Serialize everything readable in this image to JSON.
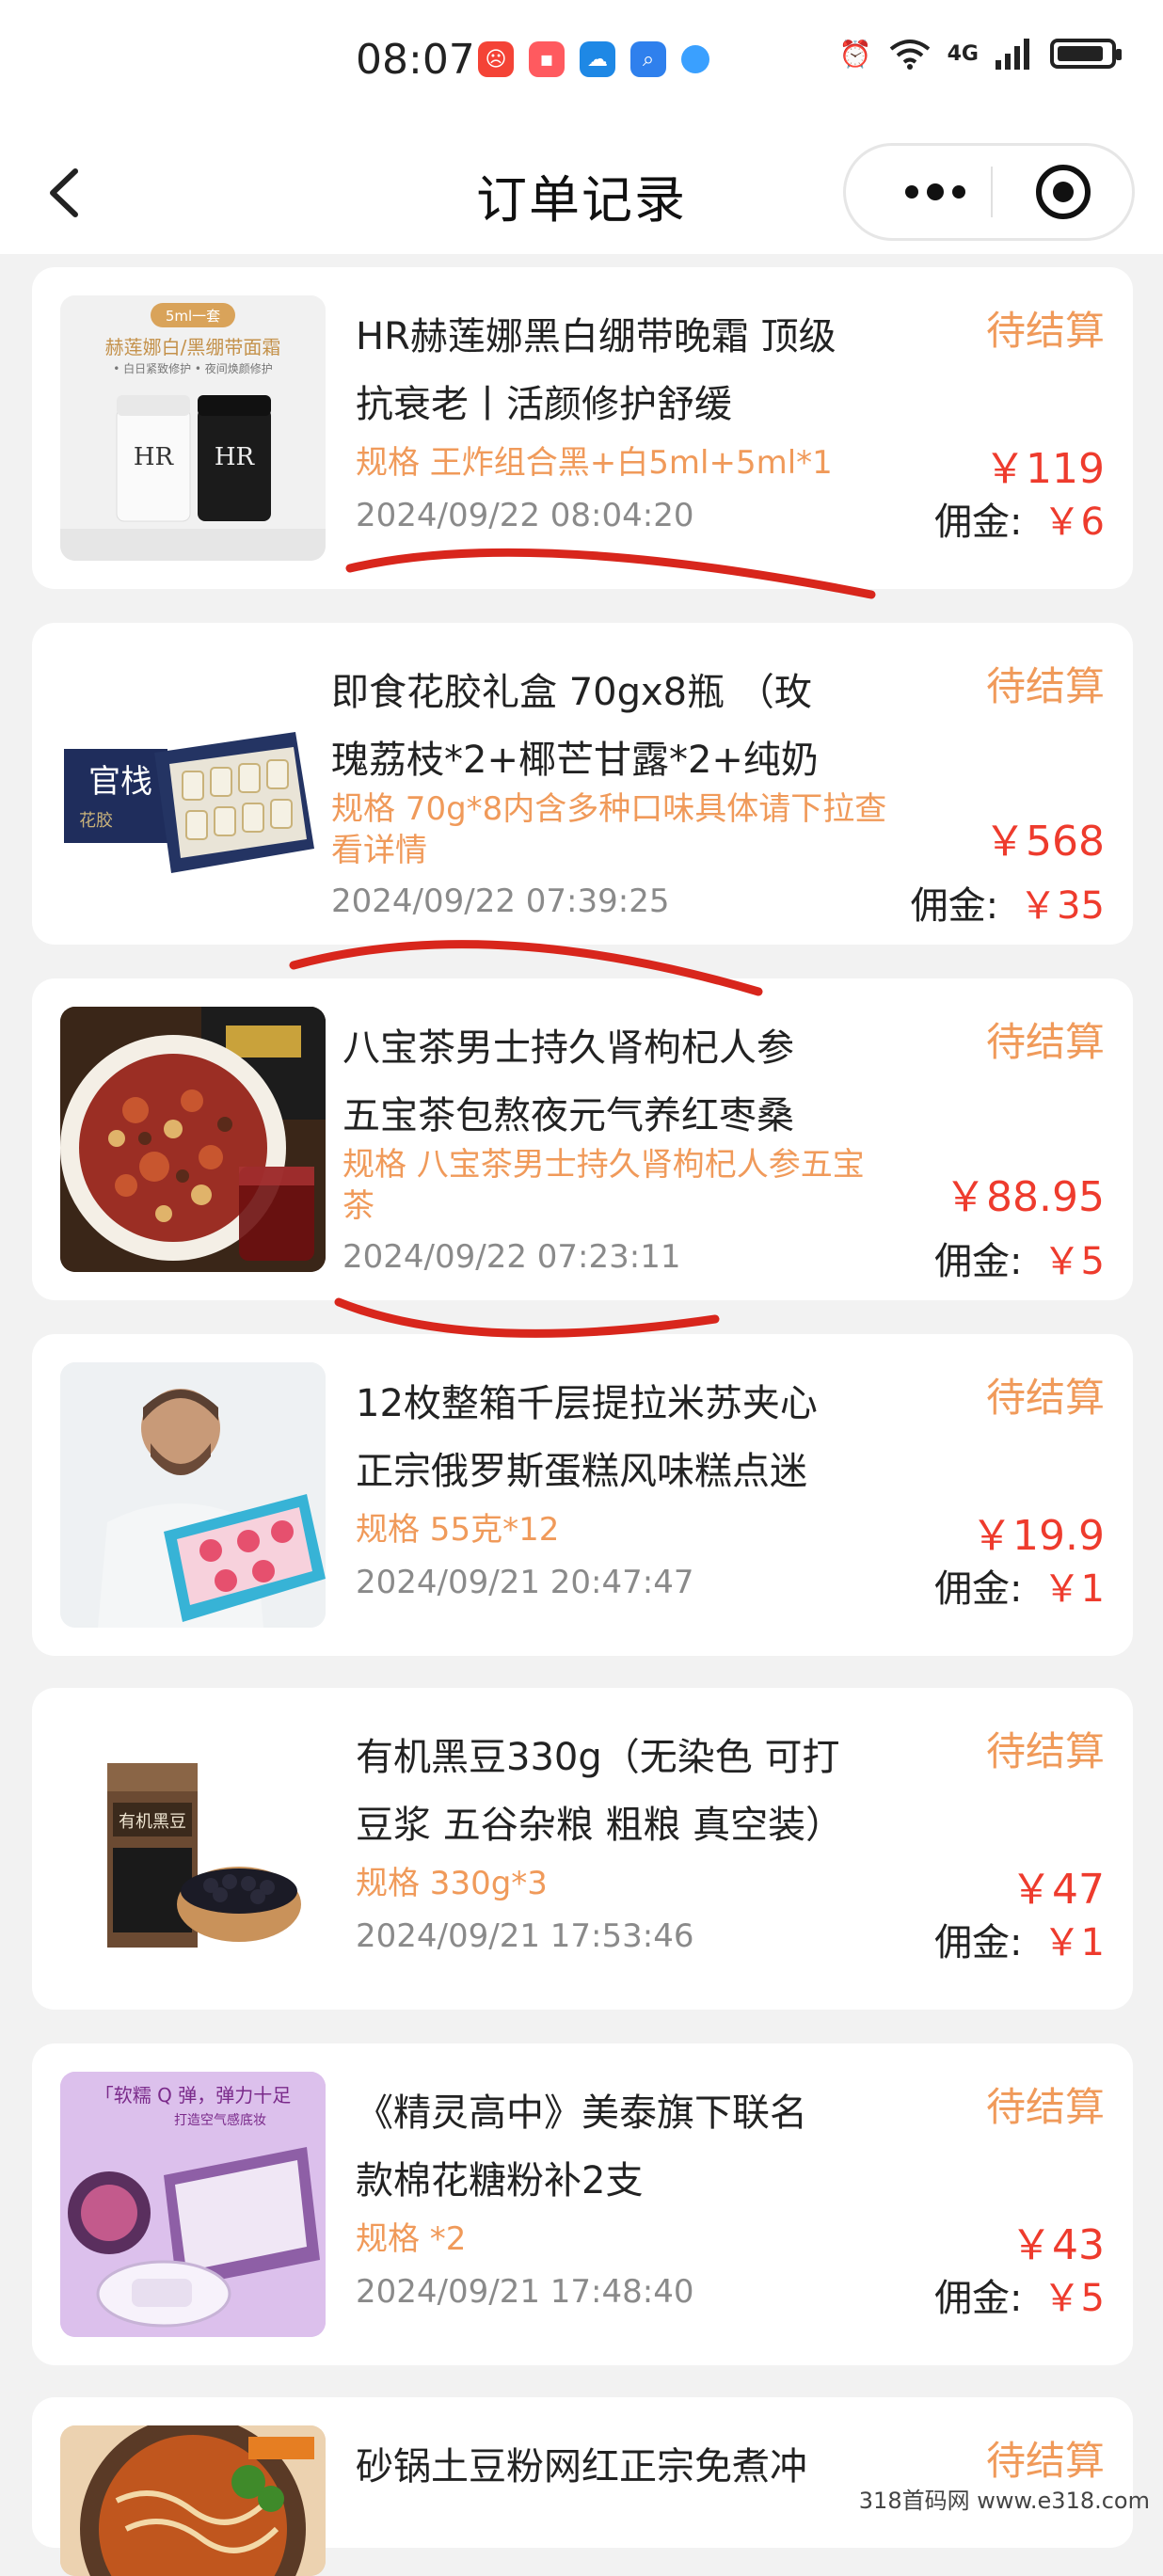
{
  "status_bar": {
    "time": "08:07",
    "network": "4G"
  },
  "nav": {
    "title": "订单记录"
  },
  "orders": [
    {
      "title": "HR赫莲娜黑白绷带晚霜 顶级抗衰老丨活颜修护舒缓",
      "title_line1": "HR赫莲娜黑白绷带晚霜 顶级",
      "title_line2": "抗衰老丨活颜修护舒缓",
      "spec": "规格 王炸组合黑+白5ml+5ml*1",
      "date": "2024/09/22 08:04:20",
      "status": "待结算",
      "price": "￥119",
      "commission_label": "佣金:",
      "commission_value": "￥6"
    },
    {
      "title": "即食花胶礼盒 70gx8瓶 （玫瑰荔枝*2+椰芒甘露*2+纯奶",
      "title_line1": "即食花胶礼盒 70gx8瓶 （玫",
      "title_line2": "瑰荔枝*2+椰芒甘露*2+纯奶",
      "spec": "规格 70g*8内含多种口味具体请下拉查看详情",
      "spec_line1": "规格 70g*8内含多种口味具体请下拉查",
      "spec_line2": "看详情",
      "date": "2024/09/22 07:39:25",
      "status": "待结算",
      "price": "￥568",
      "commission_label": "佣金:",
      "commission_value": "￥35"
    },
    {
      "title": "八宝茶男士持久肾枸杞人参五宝茶包熬夜元气养红枣桑",
      "title_line1": "八宝茶男士持久肾枸杞人参",
      "title_line2": "五宝茶包熬夜元气养红枣桑",
      "spec": "规格 八宝茶男士持久肾枸杞人参五宝茶",
      "spec_line1": "规格 八宝茶男士持久肾枸杞人参五宝",
      "spec_line2": "茶",
      "date": "2024/09/22 07:23:11",
      "status": "待结算",
      "price": "￥88.95",
      "commission_label": "佣金:",
      "commission_value": "￥5"
    },
    {
      "title": "12枚整箱千层提拉米苏夹心正宗俄罗斯蛋糕风味糕点迷",
      "title_line1": "12枚整箱千层提拉米苏夹心",
      "title_line2": "正宗俄罗斯蛋糕风味糕点迷",
      "spec": "规格 55克*12",
      "date": "2024/09/21 20:47:47",
      "status": "待结算",
      "price": "￥19.9",
      "commission_label": "佣金:",
      "commission_value": "￥1"
    },
    {
      "title": "有机黑豆330g（无染色 可打豆浆 五谷杂粮 粗粮 真空装）",
      "title_line1": "有机黑豆330g（无染色 可打",
      "title_line2": "豆浆 五谷杂粮 粗粮 真空装）",
      "spec": "规格 330g*3",
      "date": "2024/09/21 17:53:46",
      "status": "待结算",
      "price": "￥47",
      "commission_label": "佣金:",
      "commission_value": "￥1"
    },
    {
      "title": "《精灵高中》美泰旗下联名款棉花糖粉补2支",
      "title_line1": "《精灵高中》美泰旗下联名",
      "title_line2": "款棉花糖粉补2支",
      "spec": "规格 *2",
      "date": "2024/09/21 17:48:40",
      "status": "待结算",
      "price": "￥43",
      "commission_label": "佣金:",
      "commission_value": "￥5"
    },
    {
      "title": "砂锅土豆粉网红正宗免煮冲",
      "title_line1": "砂锅土豆粉网红正宗免煮冲",
      "status": "待结算"
    }
  ],
  "thumb_text": {
    "o1_badge": "5ml一套",
    "o1_caption": "赫莲娜白/黑绷带面霜",
    "o1_sub": "• 白日紧致修护  • 夜间焕颜修护",
    "o2_brand": "官栈",
    "o2_sub": "花胶",
    "o5_label": "有机黑豆",
    "o6_banner": "「软糯 Q 弹，弹力十足",
    "o6_sub": "打造空气感底妆"
  },
  "watermark": "318首码网  www.e318.com",
  "colors": {
    "accent_orange": "#f09a5a",
    "price_red": "#ee3b2d",
    "background": "#f2f2f2",
    "annotation_red": "#d8261c"
  }
}
